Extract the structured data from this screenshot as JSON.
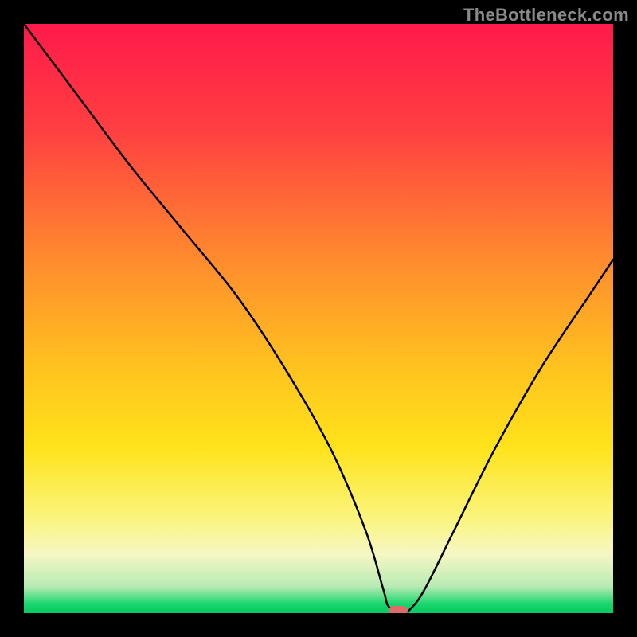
{
  "attribution": "TheBottleneck.com",
  "chart_data": {
    "type": "line",
    "title": "",
    "xlabel": "",
    "ylabel": "",
    "xlim": [
      0,
      100
    ],
    "ylim": [
      0,
      100
    ],
    "gradient_stops": [
      {
        "offset": 0.0,
        "color": "#ff1a4b"
      },
      {
        "offset": 0.18,
        "color": "#ff3f41"
      },
      {
        "offset": 0.4,
        "color": "#ff8b2e"
      },
      {
        "offset": 0.58,
        "color": "#ffc21f"
      },
      {
        "offset": 0.72,
        "color": "#ffe31b"
      },
      {
        "offset": 0.84,
        "color": "#fbf57e"
      },
      {
        "offset": 0.9,
        "color": "#f6f7c4"
      },
      {
        "offset": 0.955,
        "color": "#b8eab3"
      },
      {
        "offset": 0.985,
        "color": "#17d66d"
      },
      {
        "offset": 1.0,
        "color": "#06c95f"
      }
    ],
    "series": [
      {
        "name": "bottleneck-curve",
        "x": [
          0.0,
          9.0,
          18.0,
          27.0,
          36.0,
          44.0,
          52.0,
          58.0,
          61.0,
          62.0,
          64.5,
          65.5,
          68.0,
          73.0,
          80.0,
          88.0,
          96.0,
          100.0
        ],
        "y": [
          100.0,
          88.0,
          76.0,
          65.0,
          54.0,
          42.0,
          28.0,
          14.0,
          4.0,
          1.0,
          0.4,
          0.6,
          4.0,
          14.0,
          28.0,
          42.0,
          54.0,
          60.0
        ]
      }
    ],
    "optimal_marker": {
      "x": 63.5,
      "y": 0.4,
      "color": "#e06a6a"
    }
  }
}
